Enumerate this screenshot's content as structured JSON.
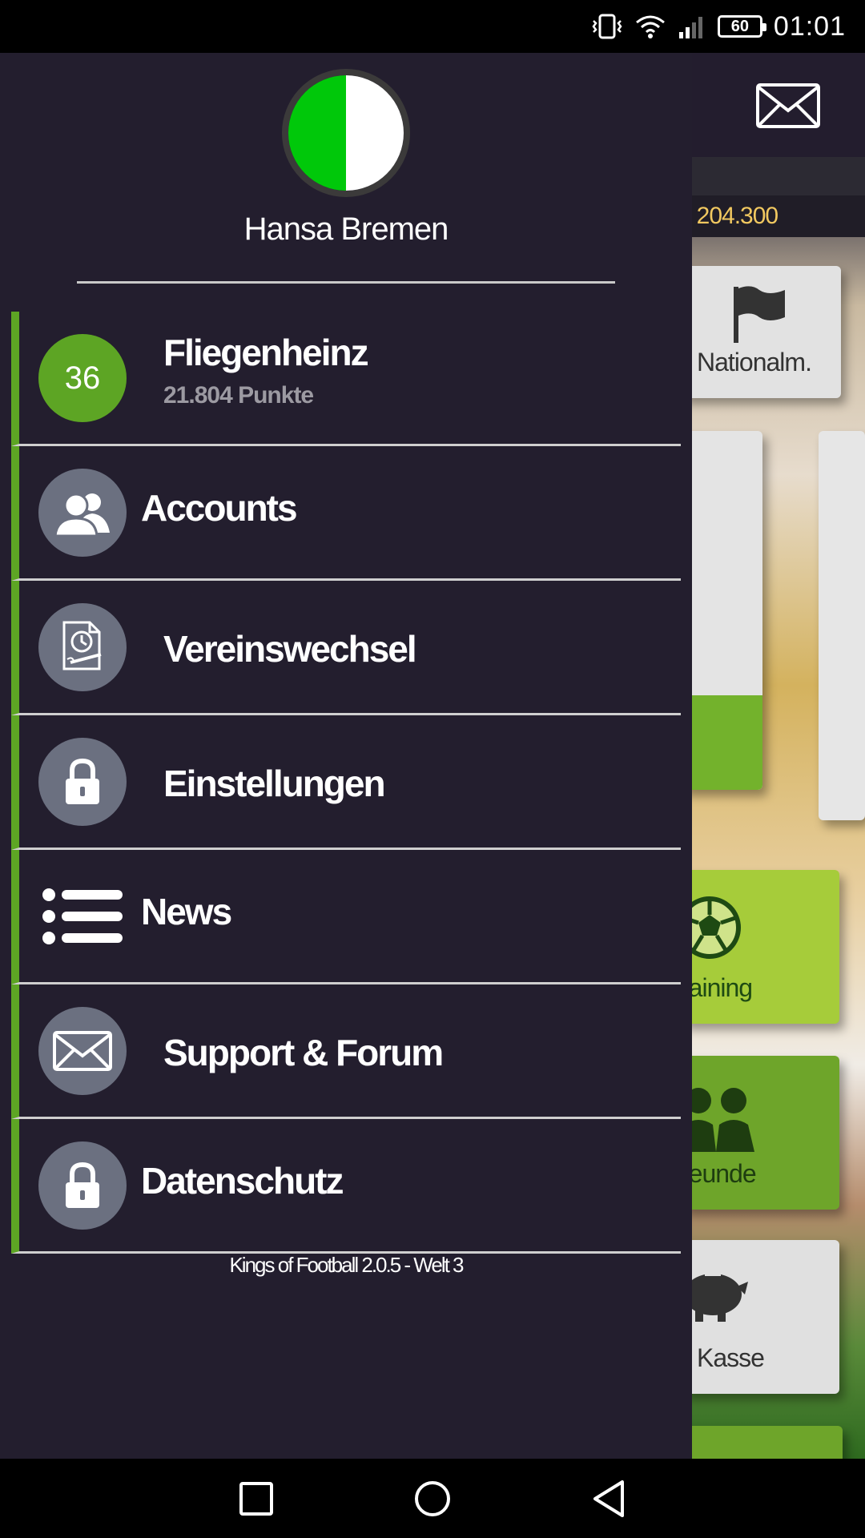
{
  "status_bar": {
    "battery_level": "60",
    "time": "01:01",
    "icons": [
      "vibrate-icon",
      "wifi-icon",
      "signal-icon",
      "battery-icon"
    ]
  },
  "background_app": {
    "money": ": 204.300",
    "tiles": {
      "national": "Nationalm.",
      "training": "raining",
      "freunde": "reunde",
      "kasse": "Kasse"
    }
  },
  "drawer": {
    "club_name": "Hansa Bremen",
    "club_colors": [
      "#00c80a",
      "#ffffff"
    ],
    "user": {
      "level": "36",
      "name": "Fliegenheinz",
      "points": "21.804 Punkte"
    },
    "menu": [
      {
        "label": "Accounts",
        "icon": "users-icon"
      },
      {
        "label": "Vereinswechsel",
        "icon": "contract-clock-icon"
      },
      {
        "label": "Einstellungen",
        "icon": "lock-icon"
      },
      {
        "label": "News",
        "icon": "list-icon"
      },
      {
        "label": "Support & Forum",
        "icon": "envelope-icon"
      },
      {
        "label": "Datenschutz",
        "icon": "lock-icon"
      }
    ],
    "version": "Kings of Football 2.0.5 - Welt 3",
    "accent_color": "#5da524"
  },
  "nav_bar": {
    "buttons": [
      "recent-apps",
      "home",
      "back"
    ]
  }
}
